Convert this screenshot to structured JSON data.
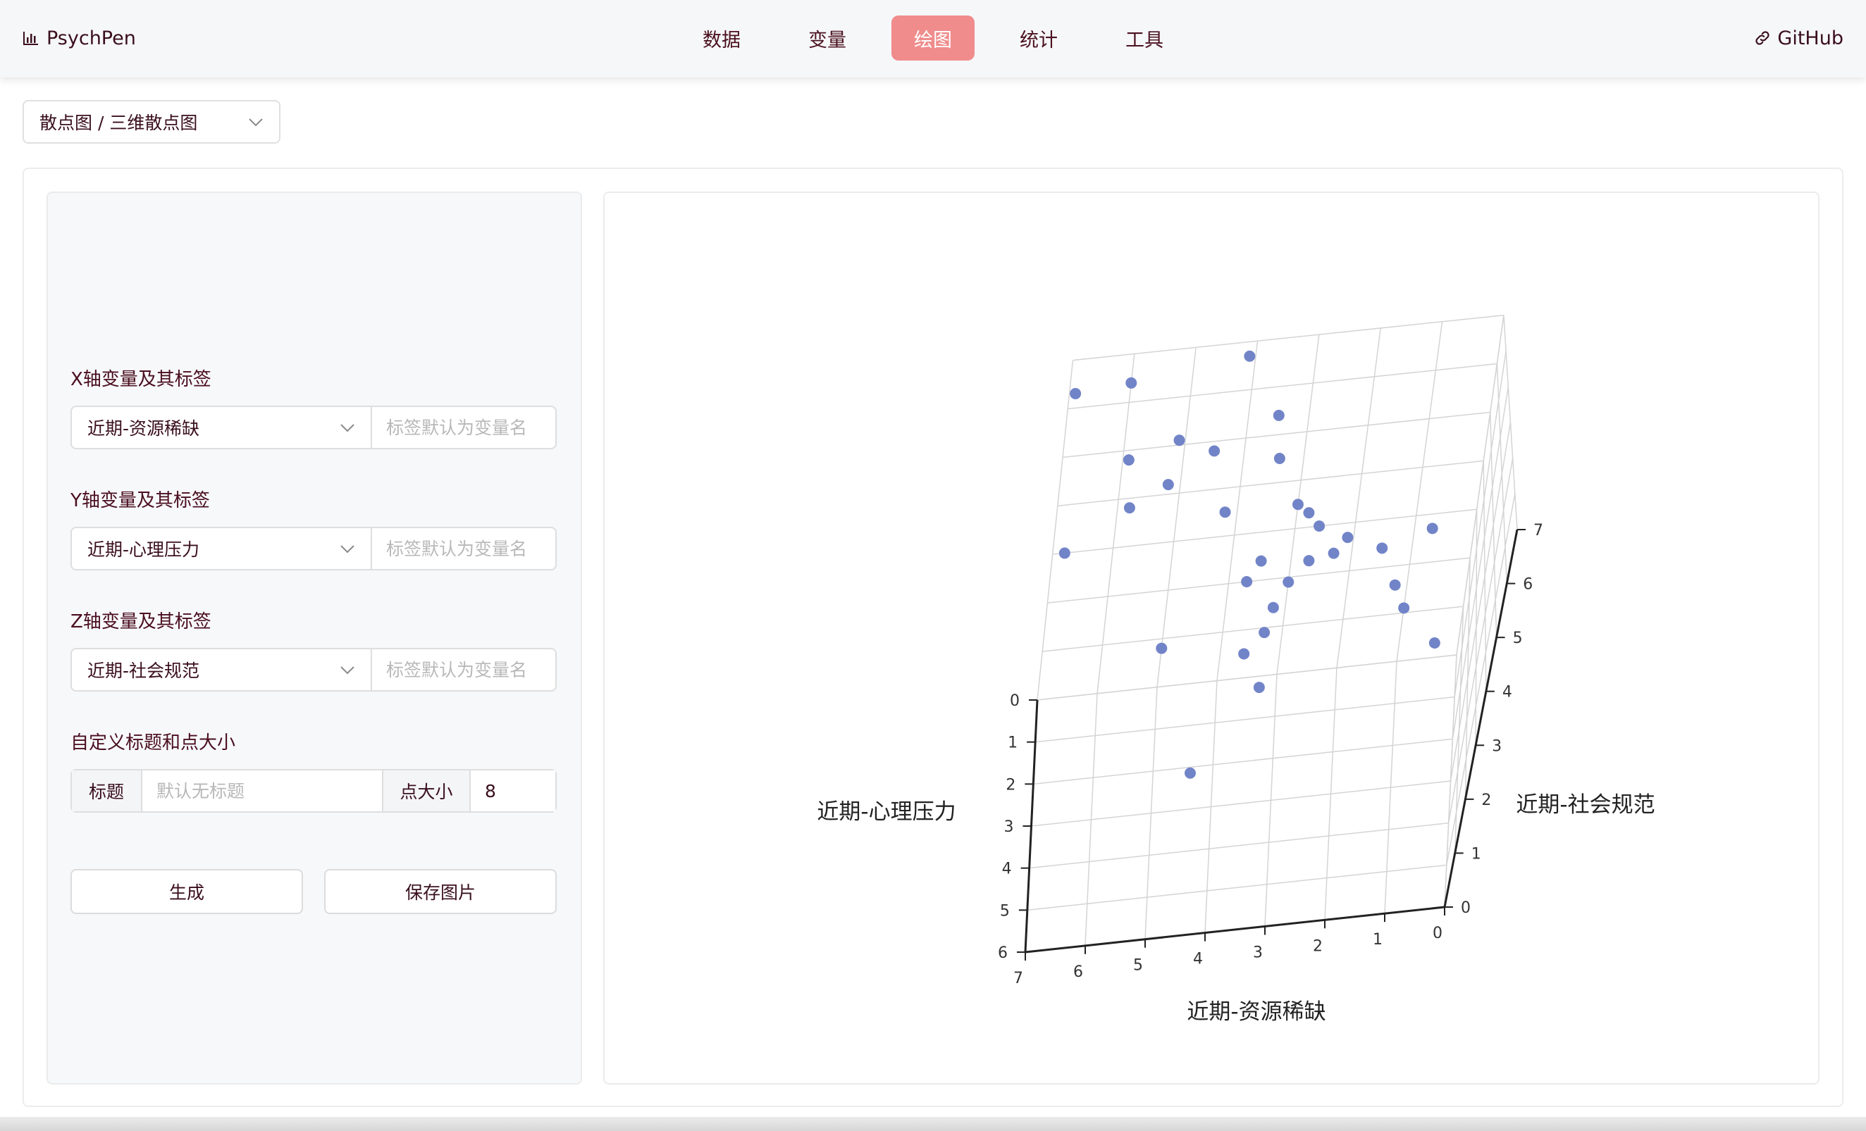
{
  "app": {
    "name": "PsychPen",
    "github_label": "GitHub"
  },
  "nav": {
    "tabs": [
      "数据",
      "变量",
      "绘图",
      "统计",
      "工具"
    ],
    "active_index": 2
  },
  "chart_type": {
    "value": "散点图 / 三维散点图"
  },
  "form": {
    "x": {
      "label": "X轴变量及其标签",
      "variable": "近期-资源稀缺",
      "placeholder": "标签默认为变量名"
    },
    "y": {
      "label": "Y轴变量及其标签",
      "variable": "近期-心理压力",
      "placeholder": "标签默认为变量名"
    },
    "z": {
      "label": "Z轴变量及其标签",
      "variable": "近期-社会规范",
      "placeholder": "标签默认为变量名"
    },
    "custom": {
      "label": "自定义标题和点大小",
      "title_addon": "标题",
      "title_placeholder": "默认无标题",
      "size_addon": "点大小",
      "size_value": "8"
    },
    "generate_label": "生成",
    "save_label": "保存图片"
  },
  "chart_data": {
    "type": "scatter",
    "dimensions": 3,
    "xlabel": "近期-资源稀缺",
    "ylabel": "近期-心理压力",
    "zlabel": "近期-社会规范",
    "x_ticks": [
      "0",
      "1",
      "2",
      "3",
      "4",
      "5",
      "6",
      "7"
    ],
    "y_ticks": [
      "0",
      "1",
      "2",
      "3",
      "4",
      "5",
      "6"
    ],
    "z_ticks": [
      "0",
      "1",
      "2",
      "3",
      "4",
      "5",
      "6",
      "7"
    ],
    "xlim": [
      0,
      7
    ],
    "ylim": [
      0,
      6
    ],
    "zlim": [
      0,
      7
    ],
    "point_color": "#7284c8",
    "point_size": 8,
    "grid": true,
    "points": [
      [
        6.0,
        0.0,
        6.4
      ],
      [
        5.9,
        0.0,
        4.8
      ],
      [
        6.9,
        0.0,
        6.3
      ],
      [
        6.8,
        0.0,
        3.0
      ],
      [
        4.5,
        0.0,
        4.8
      ],
      [
        5.1,
        0.0,
        5.1
      ],
      [
        5.2,
        0.0,
        4.2
      ],
      [
        5.8,
        0.0,
        3.8
      ],
      [
        4.1,
        0.0,
        6.7
      ],
      [
        3.5,
        0.0,
        5.4
      ],
      [
        3.4,
        0.0,
        4.5
      ],
      [
        4.2,
        0.0,
        3.5
      ],
      [
        3.5,
        0.0,
        2.4
      ],
      [
        3.7,
        0.0,
        2.0
      ],
      [
        2.8,
        0.0,
        3.3
      ],
      [
        3.0,
        0.0,
        3.5
      ],
      [
        2.6,
        0.0,
        3.0
      ],
      [
        2.7,
        0.0,
        2.3
      ],
      [
        2.1,
        0.0,
        2.7
      ],
      [
        2.3,
        0.0,
        2.4
      ],
      [
        3.0,
        0.0,
        1.9
      ],
      [
        1.5,
        0.0,
        2.4
      ],
      [
        1.2,
        0.0,
        1.6
      ],
      [
        3.3,
        0.0,
        0.9
      ],
      [
        3.6,
        0.0,
        0.5
      ],
      [
        0.7,
        0.0,
        2.7
      ],
      [
        1.0,
        0.0,
        1.1
      ],
      [
        5.0,
        0.0,
        0.8
      ],
      [
        3.2,
        0.0,
        1.4
      ],
      [
        0.4,
        0.0,
        0.3
      ],
      [
        3.3,
        0.5,
        0.2
      ],
      [
        4.4,
        2.5,
        0.3
      ]
    ]
  }
}
